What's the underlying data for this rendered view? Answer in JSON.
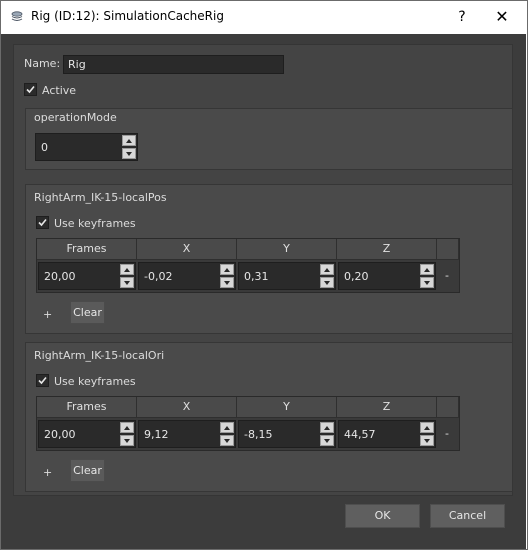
{
  "window": {
    "title": "Rig (ID:12): SimulationCacheRig",
    "help_glyph": "?",
    "close_glyph": "✕"
  },
  "name_field": {
    "label": "Name:",
    "value": "Rig"
  },
  "active": {
    "label": "Active",
    "checked": true
  },
  "operation_mode": {
    "title": "operationMode",
    "value": "0"
  },
  "groups": [
    {
      "title": "RightArm_IK-15-localPos",
      "use_keyframes": {
        "label": "Use keyframes",
        "checked": true
      },
      "columns": [
        "Frames",
        "X",
        "Y",
        "Z"
      ],
      "row": [
        "20,00",
        "-0,02",
        "0,31",
        "0,20"
      ],
      "row_remove": "-",
      "add_label": "+",
      "clear_label": "Clear"
    },
    {
      "title": "RightArm_IK-15-localOri",
      "use_keyframes": {
        "label": "Use keyframes",
        "checked": true
      },
      "columns": [
        "Frames",
        "X",
        "Y",
        "Z"
      ],
      "row": [
        "20,00",
        "9,12",
        "-8,15",
        "44,57"
      ],
      "row_remove": "-",
      "add_label": "+",
      "clear_label": "Clear"
    }
  ],
  "footer": {
    "ok_label": "OK",
    "cancel_label": "Cancel"
  }
}
